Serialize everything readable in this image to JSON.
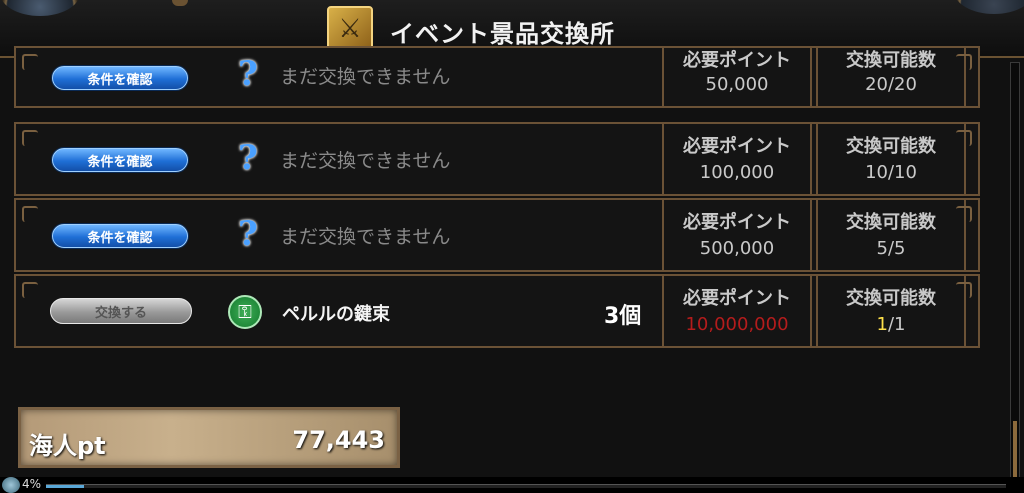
{
  "header": {
    "title": "イベント景品交換所",
    "icon": "sword-shop-icon"
  },
  "columns": {
    "points_label": "必要ポイント",
    "qty_label": "交換可能数"
  },
  "rows": [
    {
      "button": "条件を確認",
      "status": "まだ交換できません",
      "points": "50,000",
      "qty": "20/20"
    },
    {
      "button": "条件を確認",
      "status": "まだ交換できません",
      "points": "100,000",
      "qty": "10/10"
    },
    {
      "button": "条件を確認",
      "status": "まだ交換できません",
      "points": "500,000",
      "qty": "5/5"
    },
    {
      "button": "交換する",
      "item": "ペルルの鍵束",
      "count": "3個",
      "points": "10,000,000",
      "qty_current": "1",
      "qty_rest": "/1"
    }
  ],
  "points_box": {
    "label": "海人pt",
    "value": "77,443"
  },
  "bottom": {
    "percent": "4%",
    "progress": 0.04
  },
  "colors": {
    "accent_frame": "#6b5236",
    "button_blue": "#1f6fd6",
    "insufficient_red": "#b41c1c",
    "highlight_yellow": "#ffe14a"
  }
}
